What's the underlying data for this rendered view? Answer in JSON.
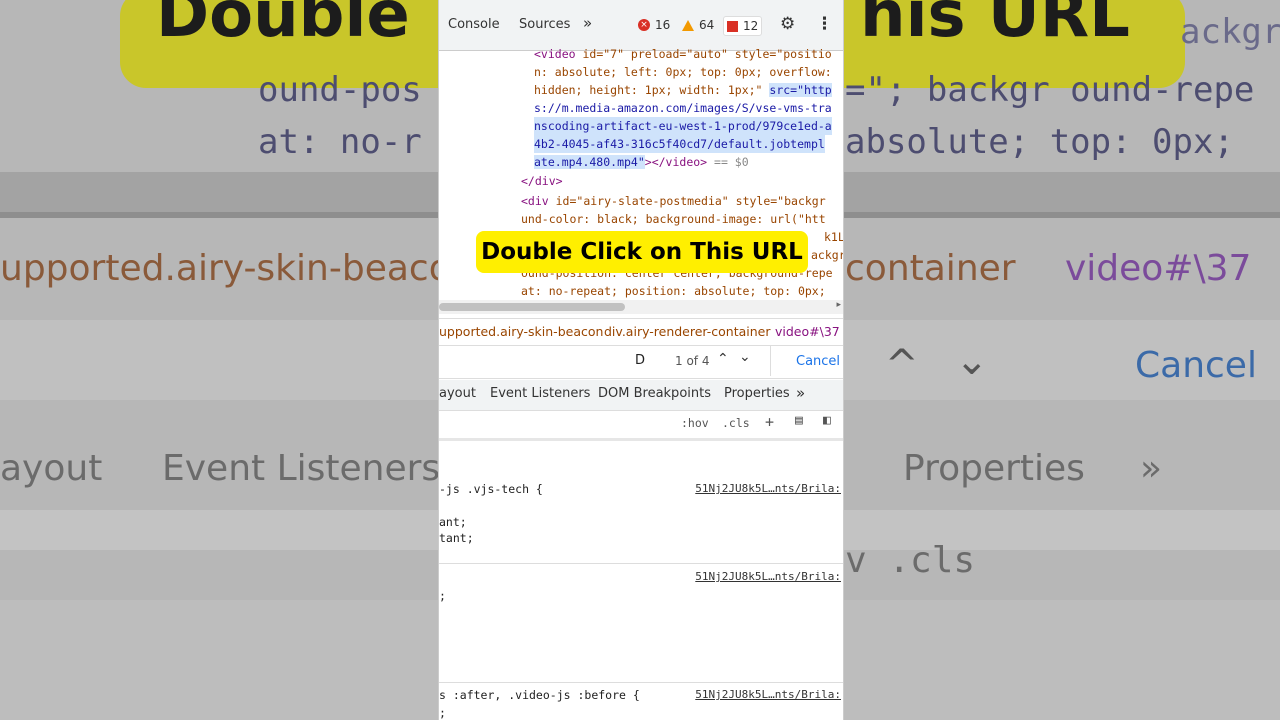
{
  "background": {
    "banner_left": "Double",
    "banner_right": "his URL",
    "code_line_1": "ound-pos",
    "code_line_1b": "=\"; backgr ound-repe",
    "code_line_2": "at: no-r",
    "code_line_2b": "absolute; top: 0px;",
    "breadcrumb_left": "upported.airy-skin-beaco",
    "breadcrumb_right_1": "container",
    "breadcrumb_right_2": "video#\\37",
    "cancel": "Cancel",
    "subtab_left_1": "ayout",
    "subtab_left_2": "Event Listeners",
    "subtab_right": "Properties",
    "toolbar_right": "v .cls"
  },
  "toolbar": {
    "tab_console": "Console",
    "tab_sources": "Sources",
    "more": "»",
    "errors": "16",
    "warnings": "64",
    "issues": "12"
  },
  "elements": {
    "line1_tag": "<video",
    "line1_attrs": " id=\"7\" preload=\"auto\" style=\"positio",
    "line2": "n: absolute; left: 0px; top: 0px; overflow:",
    "line3a": "hidden; height: 1px; width: 1px;\" ",
    "line3b": "src=\"http",
    "line4": "s://m.media-amazon.com/images/S/vse-vms-tra",
    "line5": "nscoding-artifact-eu-west-1-prod/979ce1ed-a",
    "line6": "4b2-4045-af43-316c5f40cd7/default.jobtempl",
    "line7a": "ate.mp4.480.mp4\"",
    "line7b": "></video>",
    "line7c": " == $0",
    "line8": "</div>",
    "line9a": "<div",
    "line9b": " id=\"airy-slate-postmedia\" style=\"backgr",
    "line10": "und-color: black; background-image: url(\"htt",
    "line11": "k1L.S",
    "line12": "ackgr",
    "line13": "ound-position: center center; background-repe",
    "line14": "at: no-repeat; position: absolute; top: 0px;"
  },
  "breadcrumbs": [
    "upported.airy-skin-beacon",
    "div.airy-renderer-container",
    "video#\\37"
  ],
  "search": {
    "query": "D",
    "count": "1 of 4",
    "cancel": "Cancel"
  },
  "subtabs": [
    "ayout",
    "Event Listeners",
    "DOM Breakpoints",
    "Properties",
    "»"
  ],
  "styles_toolbar": {
    "hov": ":hov",
    "cls": ".cls"
  },
  "rules": [
    {
      "selector": "-js .vjs-tech {",
      "lines": [
        "ant;",
        "tant;"
      ],
      "source": "51Nj2JU8k5L…nts/Brila:"
    },
    {
      "selector": "",
      "lines": [
        ";"
      ],
      "source": "51Nj2JU8k5L…nts/Brila:"
    },
    {
      "selector": "s :after, .video-js :before {",
      "lines": [
        ";"
      ],
      "source": "51Nj2JU8k5L…nts/Brila:"
    }
  ],
  "overlay": {
    "text": "Double Click on This URL"
  }
}
